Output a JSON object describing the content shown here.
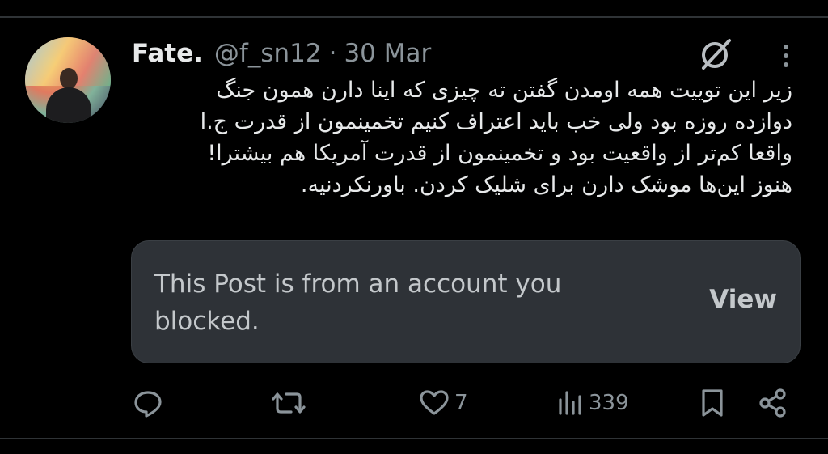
{
  "post": {
    "author_name": "Fate.",
    "author_handle": "@f_sn12",
    "separator": "·",
    "date": "30 Mar",
    "text_lines": [
      "زیر این توییت همه اومدن گفتن ته چیزی که اینا دارن همون جنگ",
      "دوازده روزه بود ولی خب باید اعتراف کنیم تخمینمون از قدرت ج.ا",
      "واقعا کم‌تر از واقعیت بود و تخمینمون از قدرت آمریکا هم بیشترا!",
      "هنوز این‌ها موشک دارن برای شلیک کردن. باورنکردنیه."
    ]
  },
  "quote": {
    "message": "This Post is from an account you blocked.",
    "view_label": "View"
  },
  "actions": {
    "reply_icon": "reply-icon",
    "retweet_icon": "retweet-icon",
    "like_icon": "like-icon",
    "like_count": "7",
    "views_icon": "views-icon",
    "views_count": "339",
    "bookmark_icon": "bookmark-icon",
    "share_icon": "share-icon"
  },
  "colors": {
    "background": "#000000",
    "text": "#e7e9ea",
    "muted": "#8b949a",
    "quote_bg": "#2e3237"
  }
}
